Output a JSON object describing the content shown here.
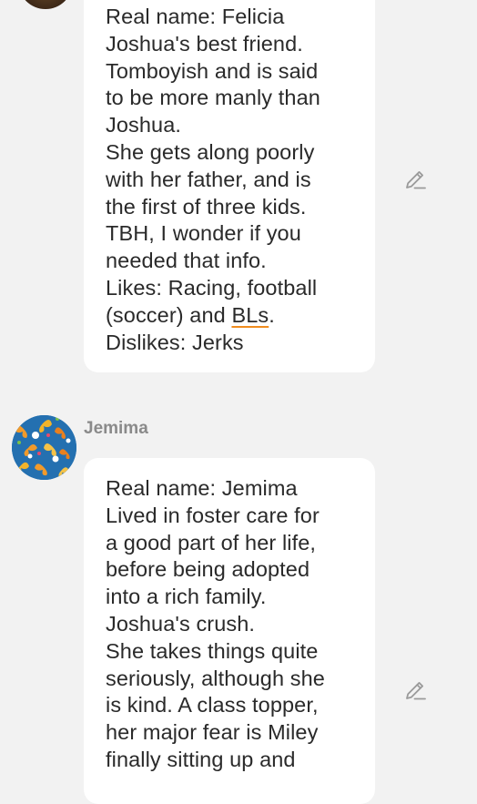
{
  "messages": [
    {
      "lines": [
        "Real name: Felicia",
        "Joshua's best friend.",
        "Tomboyish and is said",
        "to be more manly than",
        "Joshua.",
        "She gets along poorly",
        "with her father, and is",
        "the first of three kids.",
        "TBH, I wonder if you",
        "needed that info.",
        "Likes: Racing, football",
        "(soccer) and ",
        "BLs",
        ".",
        "Dislikes: Jerks"
      ],
      "edit_icon": "pencil-icon"
    },
    {
      "sender": "Jemima",
      "avatar_icon": "butterfly-avatar",
      "lines": [
        "Real name: Jemima",
        "Lived in foster care for",
        "a good part of her life,",
        "before being adopted",
        "into a rich family.",
        "Joshua's crush.",
        "She takes things quite",
        "seriously, although she",
        "is kind. A class topper,",
        "her major fear is Miley",
        "finally sitting up and"
      ],
      "edit_icon": "pencil-icon"
    }
  ],
  "colors": {
    "background": "#f2f2f2",
    "bubble": "#ffffff",
    "text": "#2a2a2a",
    "sender": "#8a8a8a",
    "underline_accent": "#f08c1e",
    "icon": "#9a9a9a"
  }
}
